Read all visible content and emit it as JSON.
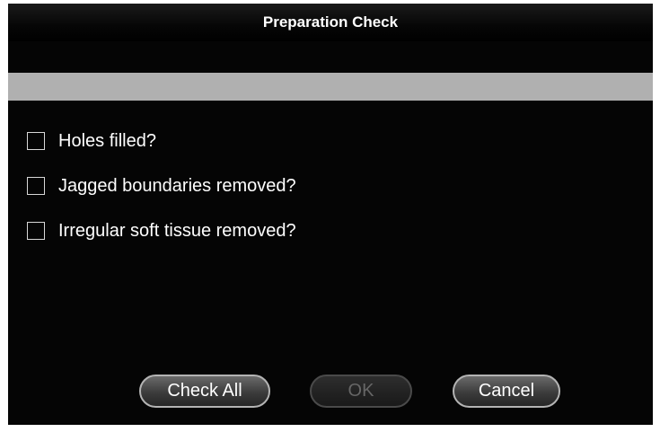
{
  "window": {
    "title": "Preparation Check"
  },
  "checklist": {
    "items": [
      {
        "label": "Holes filled?",
        "checked": false
      },
      {
        "label": "Jagged boundaries removed?",
        "checked": false
      },
      {
        "label": "Irregular soft tissue removed?",
        "checked": false
      }
    ]
  },
  "buttons": {
    "check_all": "Check All",
    "ok": "OK",
    "ok_enabled": false,
    "cancel": "Cancel"
  },
  "colors": {
    "background": "#050505",
    "strip": "#b0b0b0",
    "text": "#ffffff"
  }
}
